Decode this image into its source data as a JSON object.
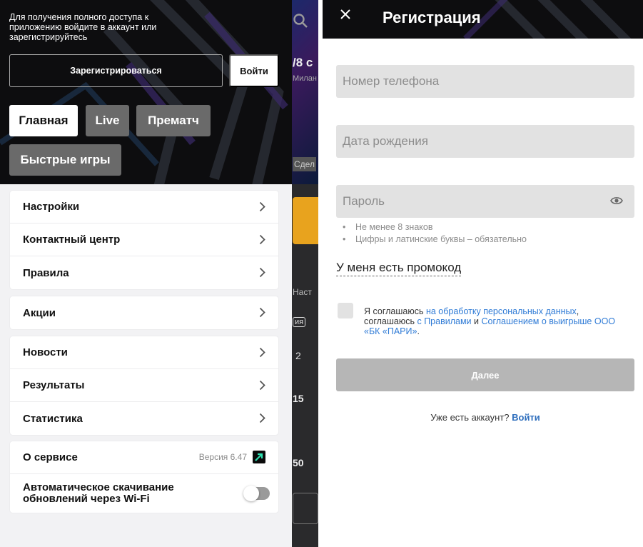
{
  "left_screen": {
    "background_app": {
      "score_text": "/8 с",
      "sub_text": "Милан",
      "button_text": "Сдел",
      "tab_text": "Наст",
      "tag_text": "ия",
      "num_a": "2",
      "num_b": "15",
      "num_c": "50"
    },
    "drawer": {
      "header_text": "Для получения полного доступа к приложению войдите в аккаунт или зарегистрируйтесь",
      "register_label": "Зарегистрироваться",
      "login_label": "Войти",
      "nav": {
        "main": "Главная",
        "live": "Live",
        "prematch": "Прематч",
        "fast_games": "Быстрые игры"
      },
      "menu_group1": [
        "Настройки",
        "Контактный центр",
        "Правила"
      ],
      "menu_group2": [
        "Акции"
      ],
      "menu_group3": [
        "Новости",
        "Результаты",
        "Статистика"
      ],
      "about_label": "О сервисе",
      "version_text": "Версия 6.47",
      "auto_update_label": "Автоматическое скачивание обновлений через Wi-Fi",
      "auto_update_enabled": false
    }
  },
  "right_screen": {
    "title": "Регистрация",
    "close_icon": "close-icon",
    "phone_placeholder": "Номер телефона",
    "dob_placeholder": "Дата рождения",
    "password_placeholder": "Пароль",
    "password_hints": [
      "Не менее 8 знаков",
      "Цифры и латинские буквы – обязательно"
    ],
    "promo_label": "У меня есть промокод",
    "agree": {
      "t1": "Я соглашаюсь ",
      "link1": "на обработку персональных данных",
      "t2": ", соглашаюсь ",
      "link2": "с Правилами",
      "t3": " и ",
      "link3": "Соглашением о выигрыше ООО «БК «ПАРИ»",
      "t4": "."
    },
    "next_label": "Далее",
    "have_account_text": "Уже есть аккаунт?",
    "have_account_link": "Войти"
  },
  "colors": {
    "header_dark": "#0d0d0f",
    "chip_inactive": "#6a6a6a",
    "field_bg": "#e2e2e2",
    "link_blue": "#2f7bd6",
    "button_disabled": "#b6b6b6"
  }
}
